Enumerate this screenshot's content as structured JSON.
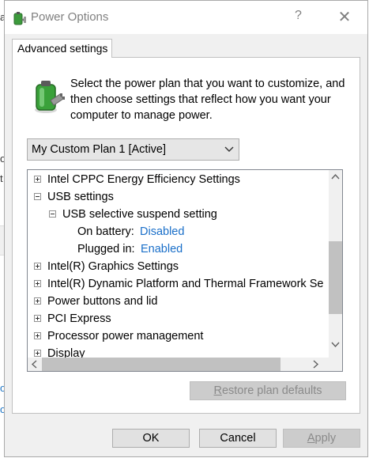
{
  "background": {
    "fragments": [
      "a",
      "o",
      "t",
      "o",
      "o"
    ]
  },
  "window": {
    "title": "Power Options",
    "help_glyph": "?",
    "close_glyph": "✕"
  },
  "tabs": [
    {
      "label": "Advanced settings",
      "selected": true
    }
  ],
  "description": "Select the power plan that you want to customize, and then choose settings that reflect how you want your computer to manage power.",
  "plan_select": {
    "value": "My Custom Plan 1 [Active]"
  },
  "settings_tree": [
    {
      "label": "Intel CPPC Energy Efficiency Settings",
      "expander": "plus",
      "level": 0
    },
    {
      "label": "USB settings",
      "expander": "minus",
      "level": 0
    },
    {
      "label": "USB selective suspend setting",
      "expander": "minus",
      "level": 1
    },
    {
      "label": "On battery:",
      "value": "Disabled",
      "level": 2
    },
    {
      "label": "Plugged in:",
      "value": "Enabled",
      "level": 2
    },
    {
      "label": "Intel(R) Graphics Settings",
      "expander": "plus",
      "level": 0
    },
    {
      "label": "Intel(R) Dynamic Platform and Thermal Framework Se",
      "expander": "plus",
      "level": 0
    },
    {
      "label": "Power buttons and lid",
      "expander": "plus",
      "level": 0
    },
    {
      "label": "PCI Express",
      "expander": "plus",
      "level": 0
    },
    {
      "label": "Processor power management",
      "expander": "plus",
      "level": 0
    },
    {
      "label": "Display",
      "expander": "plus",
      "level": 0
    }
  ],
  "buttons": {
    "restore": {
      "pre": "",
      "u": "R",
      "post": "estore plan defaults",
      "enabled": false
    },
    "ok": "OK",
    "cancel": "Cancel",
    "apply": {
      "pre": "",
      "u": "A",
      "post": "pply",
      "enabled": false
    }
  },
  "colors": {
    "link": "#1a6fc9",
    "dialog_bg": "#f0f0f0"
  }
}
